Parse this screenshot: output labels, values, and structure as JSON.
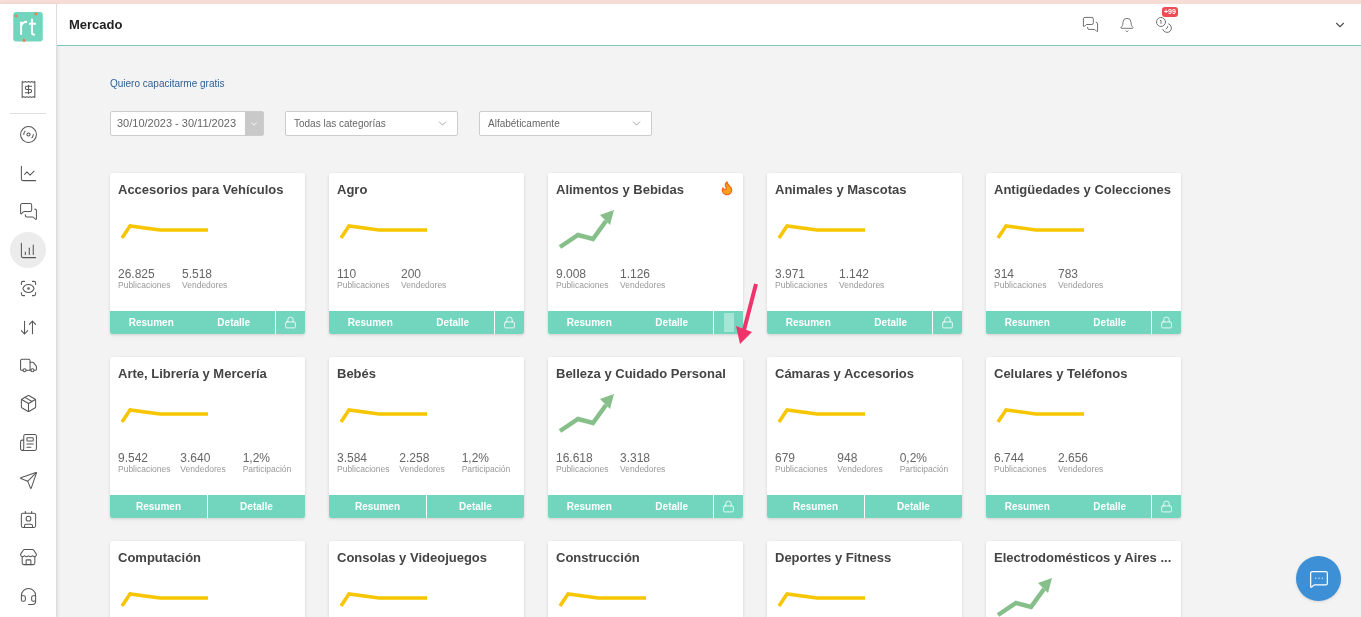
{
  "header": {
    "title": "Mercado",
    "badge": "+99"
  },
  "sidebar": {
    "items": [
      {
        "selected": false
      },
      {
        "selected": false
      },
      {
        "selected": false
      },
      {
        "selected": false
      },
      {
        "selected": true
      },
      {
        "selected": false
      },
      {
        "selected": false
      },
      {
        "selected": false
      },
      {
        "selected": false
      },
      {
        "selected": false
      },
      {
        "selected": false
      },
      {
        "selected": false
      },
      {
        "selected": false
      },
      {
        "selected": false
      }
    ]
  },
  "training_link": "Quiero capacitarme gratis",
  "filters": {
    "date_range": "30/10/2023 - 30/11/2023",
    "category": "Todas las categorías",
    "sort": "Alfabéticamente"
  },
  "cards": [
    {
      "title": "Accesorios para Vehículos",
      "kind": "flat",
      "hot": false,
      "stats": [
        {
          "value": "26.825",
          "label": "Publicaciones"
        },
        {
          "value": "5.518",
          "label": "Vendedores"
        }
      ],
      "actions": [
        "Resumen",
        "Detalle"
      ],
      "lock": true,
      "lock_faded": false
    },
    {
      "title": "Agro",
      "kind": "flat",
      "hot": false,
      "stats": [
        {
          "value": "110",
          "label": "Publicaciones"
        },
        {
          "value": "200",
          "label": "Vendedores"
        }
      ],
      "actions": [
        "Resumen",
        "Detalle"
      ],
      "lock": true,
      "lock_faded": false
    },
    {
      "title": "Alimentos y Bebidas",
      "kind": "rising",
      "hot": true,
      "stats": [
        {
          "value": "9.008",
          "label": "Publicaciones"
        },
        {
          "value": "1.126",
          "label": "Vendedores"
        }
      ],
      "actions": [
        "Resumen",
        "Detalle"
      ],
      "lock": true,
      "lock_faded": true
    },
    {
      "title": "Animales y Mascotas",
      "kind": "flat",
      "hot": false,
      "stats": [
        {
          "value": "3.971",
          "label": "Publicaciones"
        },
        {
          "value": "1.142",
          "label": "Vendedores"
        }
      ],
      "actions": [
        "Resumen",
        "Detalle"
      ],
      "lock": true,
      "lock_faded": false
    },
    {
      "title": "Antigüedades y Colecciones",
      "kind": "flat",
      "hot": false,
      "stats": [
        {
          "value": "314",
          "label": "Publicaciones"
        },
        {
          "value": "783",
          "label": "Vendedores"
        }
      ],
      "actions": [
        "Resumen",
        "Detalle"
      ],
      "lock": true,
      "lock_faded": false
    },
    {
      "title": "Arte, Librería y Mercería",
      "kind": "flat",
      "hot": false,
      "stats": [
        {
          "value": "9.542",
          "label": "Publicaciones"
        },
        {
          "value": "3.640",
          "label": "Vendedores"
        },
        {
          "value": "1,2%",
          "label": "Participación"
        }
      ],
      "actions": [
        "Resumen",
        "Detalle"
      ],
      "lock": false
    },
    {
      "title": "Bebés",
      "kind": "flat",
      "hot": false,
      "stats": [
        {
          "value": "3.584",
          "label": "Publicaciones"
        },
        {
          "value": "2.258",
          "label": "Vendedores"
        },
        {
          "value": "1,2%",
          "label": "Participación"
        }
      ],
      "actions": [
        "Resumen",
        "Detalle"
      ],
      "lock": false
    },
    {
      "title": "Belleza y Cuidado Personal",
      "kind": "rising",
      "hot": false,
      "stats": [
        {
          "value": "16.618",
          "label": "Publicaciones"
        },
        {
          "value": "3.318",
          "label": "Vendedores"
        }
      ],
      "actions": [
        "Resumen",
        "Detalle"
      ],
      "lock": true,
      "lock_faded": false
    },
    {
      "title": "Cámaras y Accesorios",
      "kind": "flat",
      "hot": false,
      "stats": [
        {
          "value": "679",
          "label": "Publicaciones"
        },
        {
          "value": "948",
          "label": "Vendedores"
        },
        {
          "value": "0,2%",
          "label": "Participación"
        }
      ],
      "actions": [
        "Resumen",
        "Detalle"
      ],
      "lock": false
    },
    {
      "title": "Celulares y Teléfonos",
      "kind": "flat",
      "hot": false,
      "stats": [
        {
          "value": "6.744",
          "label": "Publicaciones"
        },
        {
          "value": "2.656",
          "label": "Vendedores"
        }
      ],
      "actions": [
        "Resumen",
        "Detalle"
      ],
      "lock": true,
      "lock_faded": false
    },
    {
      "title": "Computación",
      "kind": "flat",
      "hot": false
    },
    {
      "title": "Consolas y Videojuegos",
      "kind": "flat",
      "hot": false
    },
    {
      "title": "Construcción",
      "kind": "flat",
      "hot": false
    },
    {
      "title": "Deportes y Fitness",
      "kind": "flat",
      "hot": false
    },
    {
      "title": "Electrodomésticos y Aires ...",
      "kind": "rising",
      "hot": false
    }
  ]
}
